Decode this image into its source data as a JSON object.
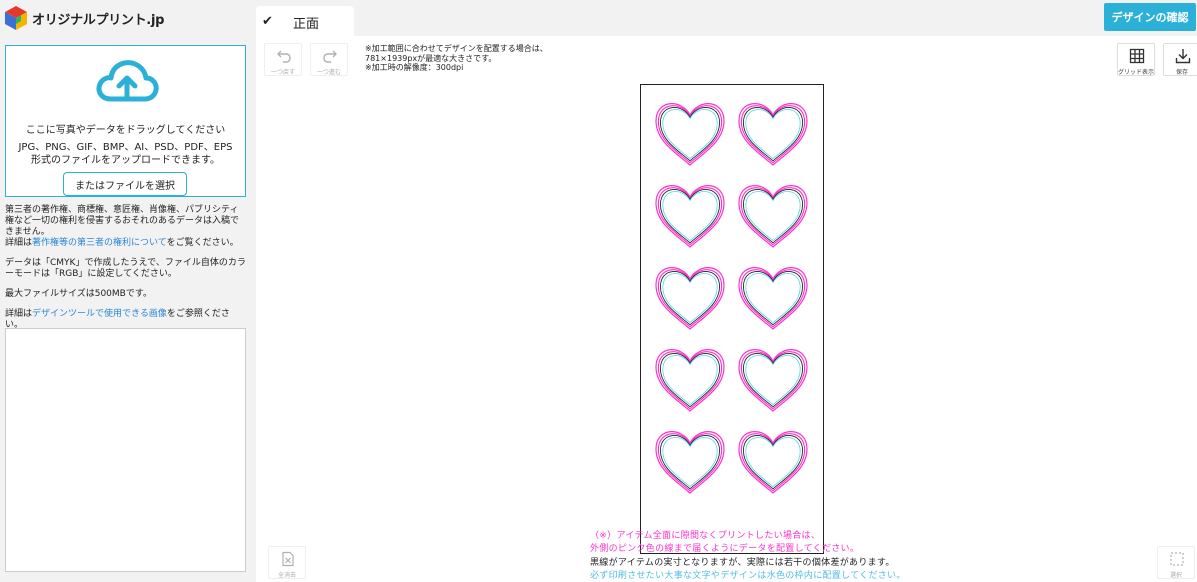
{
  "app": {
    "logo_text": "オリジナルプリント.jp",
    "tab_label": "正面",
    "confirm_button": "デザインの確認"
  },
  "upload": {
    "title": "ここに写真やデータをドラッグしてください",
    "formats_line1": "JPG、PNG、GIF、BMP、AI、PSD、PDF、EPS",
    "formats_line2": "形式のファイルをアップロードできます。",
    "file_button": "またはファイルを選択"
  },
  "notes": {
    "rights_text": "第三者の著作権、商標権、意匠権、肖像権、パブリシティ権など一切の権利を侵害するおそれのあるデータは入稿できません。",
    "rights_prefix": "詳細は",
    "rights_link": "著作権等の第三者の権利について",
    "rights_suffix": "をご覧ください。",
    "cmyk_text": "データは「CMYK」で作成したうえで、ファイル自体のカラーモードは「RGB」に設定してください。",
    "max_size": "最大ファイルサイズは500MBです。",
    "design_prefix": "詳細は",
    "design_link": "デザインツールで使用できる画像",
    "design_suffix": "をご参照ください。"
  },
  "toolbar": {
    "undo_label": "一つ戻す",
    "redo_label": "一つ進む",
    "grid_label": "グリッド表示",
    "save_label": "保存",
    "clear_label": "全消去",
    "select_label": "選択"
  },
  "hint": {
    "line1": "※加工範囲に合わせてデザインを配置する場合は、",
    "line2": "781×1939pxが最適な大きさです。",
    "line3": "※加工時の解像度：300dpi"
  },
  "canvas": {
    "heart_rows": 5,
    "heart_cols": 2
  },
  "footnote": {
    "line1": "（※）アイテム全面に隙間なくプリントしたい場合は、",
    "line2": "外側のピンク色の線まで届くようにデータを配置してください。",
    "line3": "黒線がアイテムの実寸となりますが、実際には若干の個体差があります。",
    "line4": "必ず印刷させたい大事な文字やデザインは水色の枠内に配置してください。"
  },
  "colors": {
    "accent": "#2bb0d8",
    "bleed_line": "#ff2fcf",
    "safe_line": "#4fd8e0",
    "link": "#2a86d8"
  }
}
